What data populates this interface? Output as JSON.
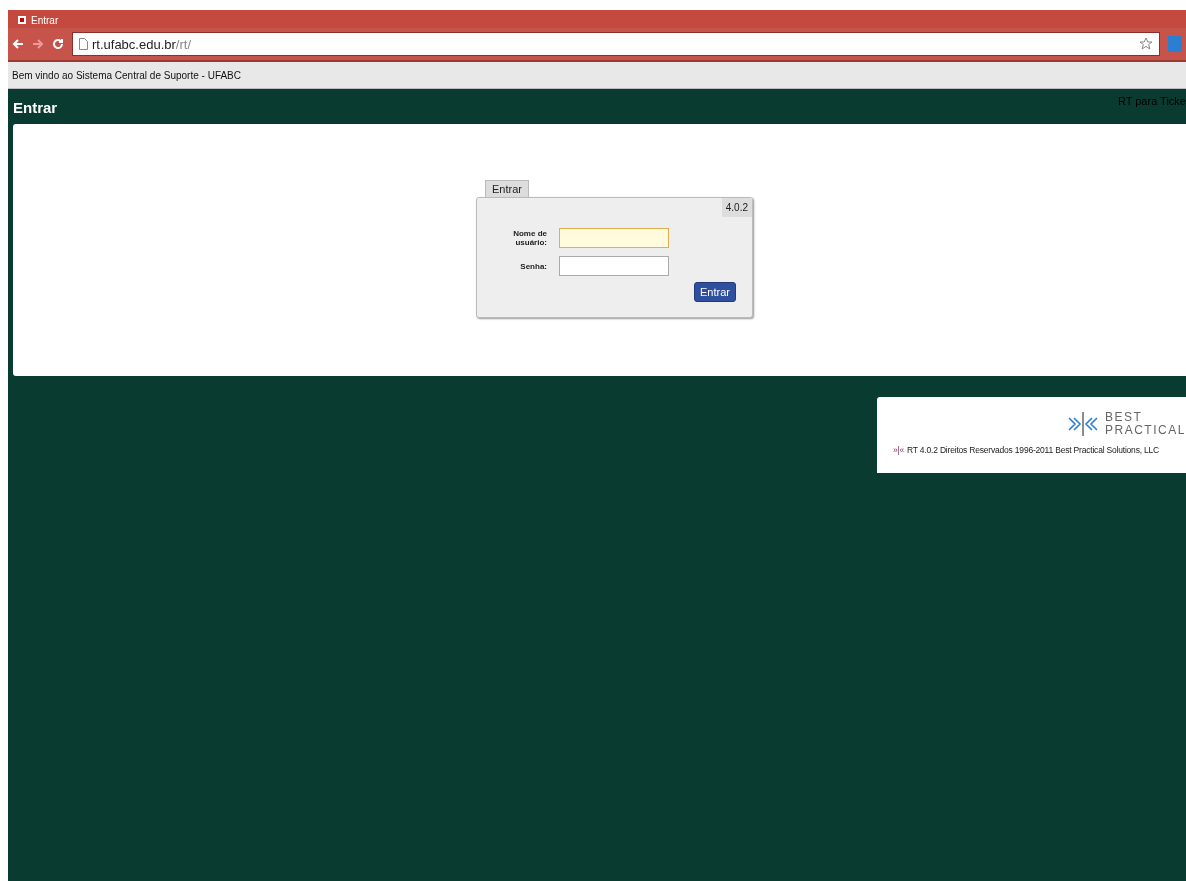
{
  "browser": {
    "tab_title": "Entrar",
    "url_host": "rt.ufabc.edu.br",
    "url_path": "/rt/"
  },
  "site_banner": "Bem vindo ao Sistema Central de Suporte - UFABC",
  "page": {
    "title": "Entrar",
    "tagline": "RT para Ticke"
  },
  "login": {
    "tab": "Entrar",
    "version": "4.0.2",
    "fields": [
      {
        "label": "Nome de usuário:",
        "focused": true
      },
      {
        "label": "Senha:",
        "focused": false
      }
    ],
    "submit": "Entrar"
  },
  "footer": {
    "logo_line_1": "BEST",
    "logo_line_2": "PRACTICAL",
    "mark": "»|«",
    "copyright": "RT 4.0.2 Direitos Reservados 1996-2011 Best Practical Solutions, LLC"
  }
}
